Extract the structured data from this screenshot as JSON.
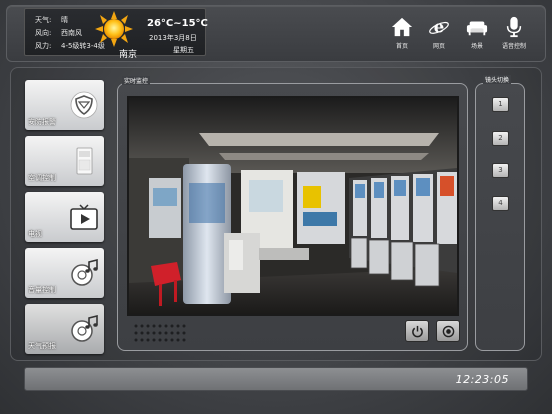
{
  "weather": {
    "rows": [
      {
        "key": "天气:",
        "value": "晴"
      },
      {
        "key": "风向:",
        "value": "西南风"
      },
      {
        "key": "风力:",
        "value": "4-5级转3-4级"
      }
    ],
    "temperature": "26°C~15°C",
    "date": "2013年3月8日",
    "weekday": "星期五",
    "city": "南京",
    "icon": "sun-icon"
  },
  "nav": [
    {
      "label": "首页",
      "icon": "home-icon"
    },
    {
      "label": "网页",
      "icon": "browser-icon"
    },
    {
      "label": "场景",
      "icon": "sofa-icon"
    },
    {
      "label": "语音控制",
      "icon": "microphone-icon"
    }
  ],
  "menu": [
    {
      "label": "安防报警",
      "icon": "shield-icon"
    },
    {
      "label": "空调控制",
      "icon": "air-conditioner-icon"
    },
    {
      "label": "电视",
      "icon": "tv-icon"
    },
    {
      "label": "音量控制",
      "icon": "music-icon"
    },
    {
      "label": "天气预报",
      "icon": "music-icon"
    }
  ],
  "monitor": {
    "title": "实时监控",
    "controls": [
      {
        "icon": "power-icon"
      },
      {
        "icon": "record-icon"
      }
    ]
  },
  "cameras": {
    "title": "镜头切换",
    "buttons": [
      "1",
      "2",
      "3",
      "4"
    ]
  },
  "status": {
    "time": "12:23:05"
  }
}
